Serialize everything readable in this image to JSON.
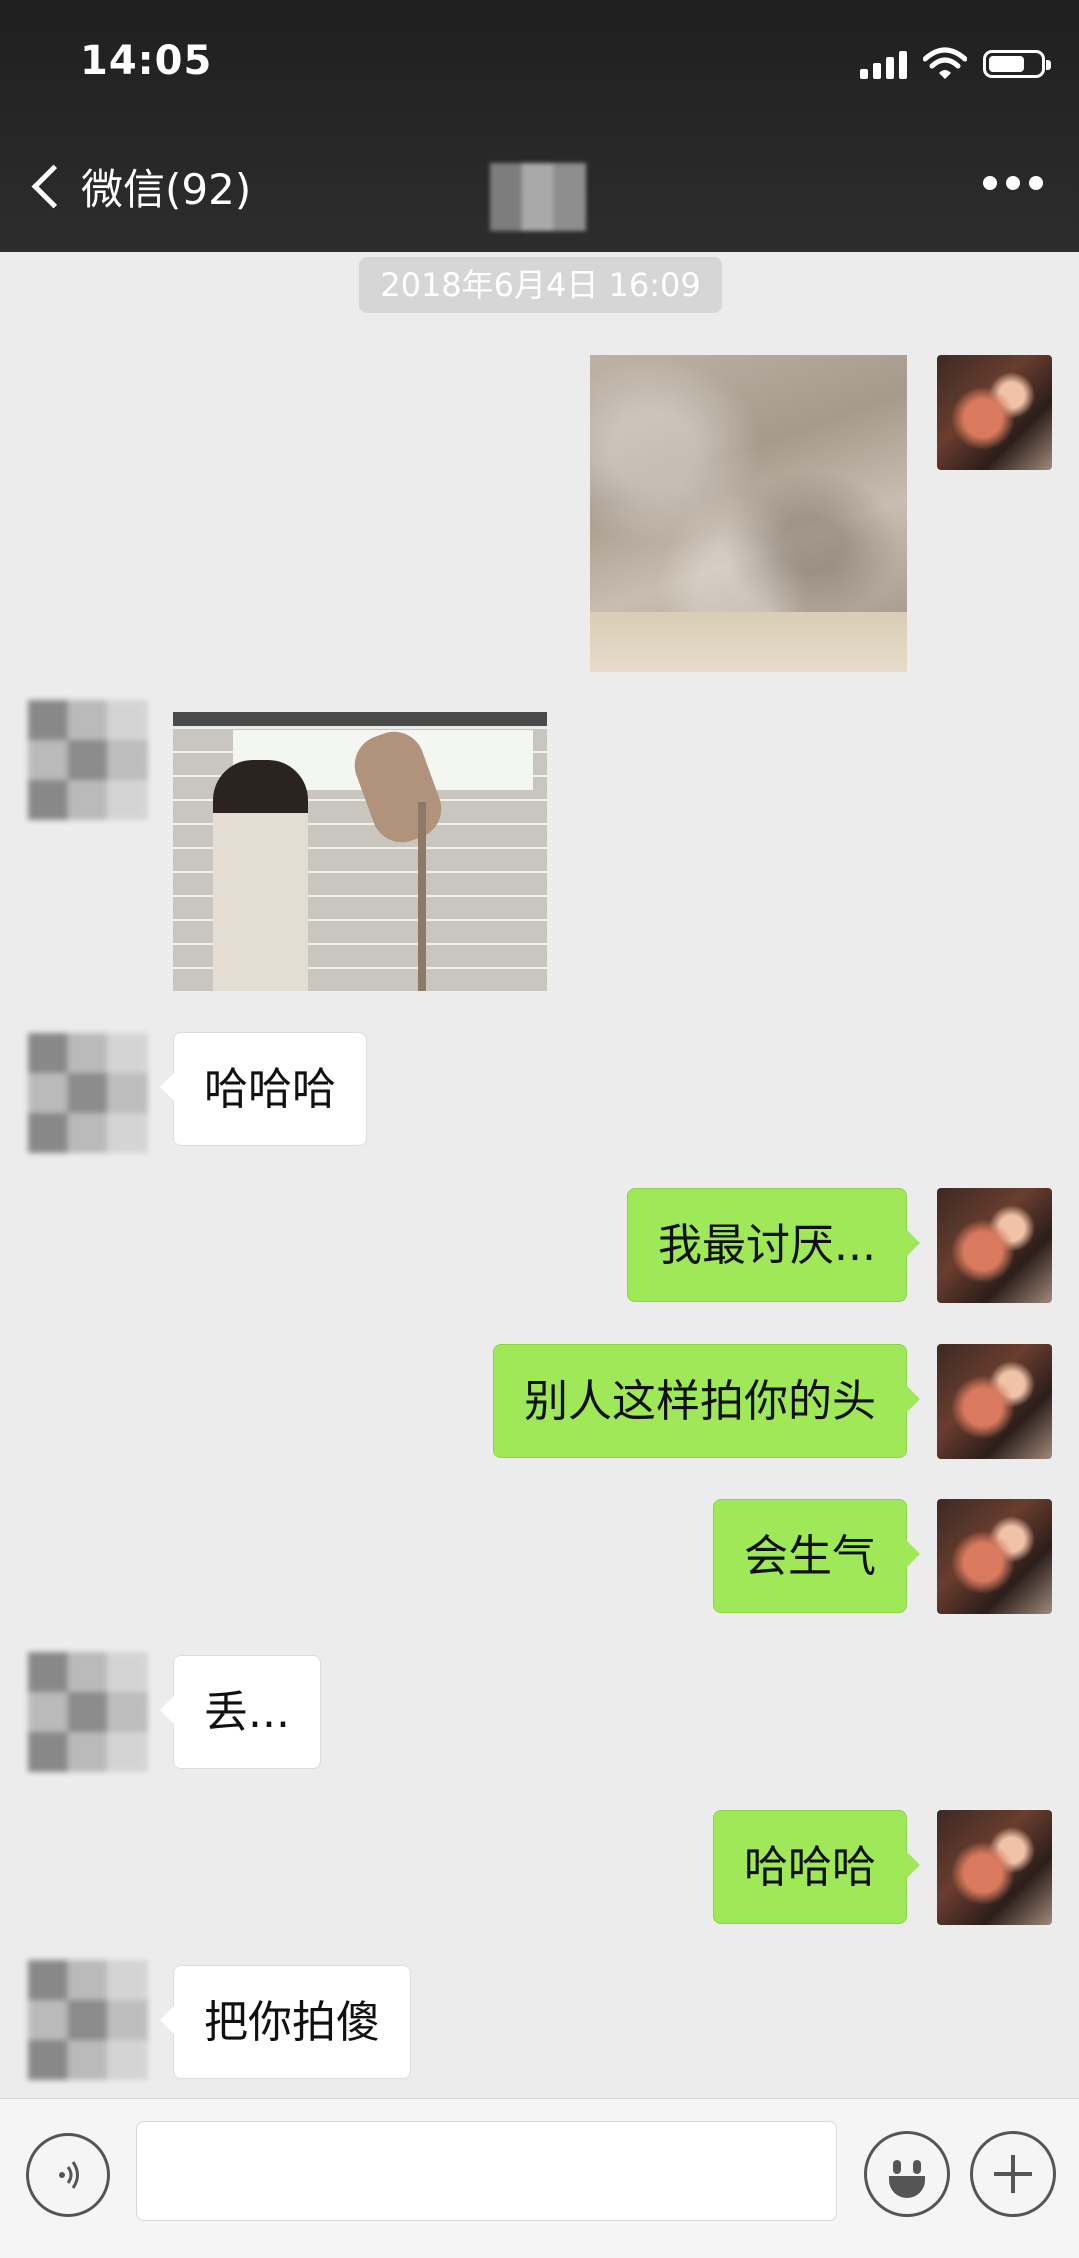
{
  "status_bar": {
    "time": "14:05",
    "icons": [
      "signal-icon",
      "wifi-icon",
      "battery-icon"
    ]
  },
  "nav": {
    "back_label": "微信(92)",
    "title": "",
    "more_icon": "more-icon"
  },
  "timestamp": "2018年6月4日 16:09",
  "messages": [
    {
      "from": "me",
      "type": "image"
    },
    {
      "from": "other",
      "type": "image"
    },
    {
      "from": "other",
      "type": "text",
      "text": "哈哈哈"
    },
    {
      "from": "me",
      "type": "text",
      "text": "我最讨厌..."
    },
    {
      "from": "me",
      "type": "text",
      "text": "别人这样拍你的头"
    },
    {
      "from": "me",
      "type": "text",
      "text": "会生气"
    },
    {
      "from": "other",
      "type": "text",
      "text": "丢..."
    },
    {
      "from": "me",
      "type": "text",
      "text": "哈哈哈"
    },
    {
      "from": "other",
      "type": "text",
      "text": "把你拍傻"
    }
  ],
  "input_bar": {
    "value": "",
    "placeholder": "",
    "voice_icon": "voice-icon",
    "emoji_icon": "emoji-icon",
    "plus_icon": "plus-icon"
  },
  "colors": {
    "outgoing_bubble": "#9fe858",
    "incoming_bubble": "#ffffff",
    "background": "#ececec",
    "header": "#2a2a2a"
  }
}
